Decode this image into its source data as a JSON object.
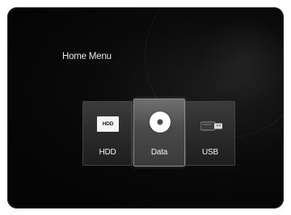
{
  "home_menu": {
    "title": "Home Menu"
  },
  "tiles": [
    {
      "label": "HDD",
      "icon": "hdd-icon",
      "icon_text": "HDD",
      "selected": false
    },
    {
      "label": "Data",
      "icon": "disc-icon",
      "selected": true
    },
    {
      "label": "USB",
      "icon": "usb-icon",
      "selected": false
    }
  ],
  "colors": {
    "background": "#060606",
    "tile": "#2a2a2a",
    "tile_selected": "#555555",
    "text": "#f2f2f2"
  }
}
